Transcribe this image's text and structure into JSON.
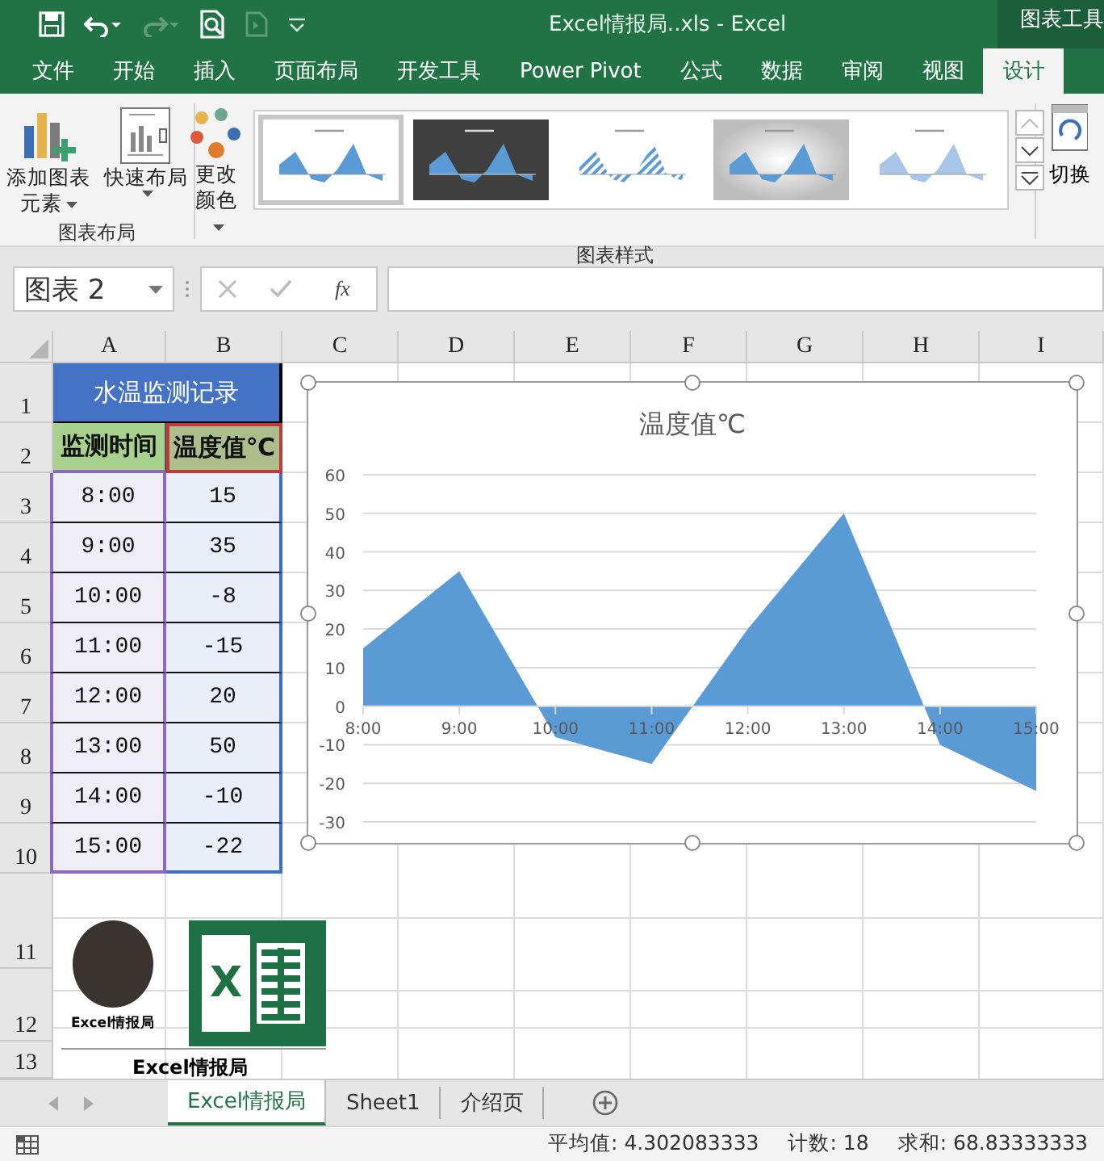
{
  "title_bar": {
    "title": "Excel情报局..xls - Excel",
    "context_tab": "图表工具"
  },
  "ribbon_tabs": [
    {
      "label": "文件",
      "selected": false
    },
    {
      "label": "开始",
      "selected": false
    },
    {
      "label": "插入",
      "selected": false
    },
    {
      "label": "页面布局",
      "selected": false
    },
    {
      "label": "开发工具",
      "selected": false
    },
    {
      "label": "Power Pivot",
      "selected": false
    },
    {
      "label": "公式",
      "selected": false
    },
    {
      "label": "数据",
      "selected": false
    },
    {
      "label": "审阅",
      "selected": false
    },
    {
      "label": "视图",
      "selected": false
    },
    {
      "label": "设计",
      "selected": true
    }
  ],
  "ribbon": {
    "layout_group": {
      "label": "图表布局",
      "buttons": [
        {
          "kind": "add",
          "label": "添加图表元素"
        },
        {
          "kind": "layout",
          "label": "快速布局"
        }
      ]
    },
    "styles_group": {
      "label": "图表样式",
      "color_button": "更改颜色",
      "styles": [
        {
          "kind": "light",
          "selected": true
        },
        {
          "kind": "dark",
          "selected": false
        },
        {
          "kind": "hatched",
          "selected": false
        },
        {
          "kind": "gradient",
          "selected": false
        },
        {
          "kind": "pale",
          "selected": false
        }
      ]
    },
    "switch_button": "切换"
  },
  "formula_bar": {
    "name_box": "图表 2",
    "function_label": "fx"
  },
  "columns": [
    "A",
    "B",
    "C",
    "D",
    "E",
    "F",
    "G",
    "H",
    "I"
  ],
  "rows": [
    "1",
    "2",
    "3",
    "4",
    "5",
    "6",
    "7",
    "8",
    "9",
    "10",
    "11",
    "12",
    "13"
  ],
  "table": {
    "title": "水温监测记录",
    "headers": [
      "监测时间",
      "温度值℃"
    ],
    "rows": [
      [
        "8:00",
        "15"
      ],
      [
        "9:00",
        "35"
      ],
      [
        "10:00",
        "-8"
      ],
      [
        "11:00",
        "-15"
      ],
      [
        "12:00",
        "20"
      ],
      [
        "13:00",
        "50"
      ],
      [
        "14:00",
        "-10"
      ],
      [
        "15:00",
        "-22"
      ]
    ]
  },
  "chart": {
    "chart_data": {
      "type": "area",
      "grid": true,
      "categories": [
        "8:00",
        "9:00",
        "10:00",
        "11:00",
        "12:00",
        "13:00",
        "14:00",
        "15:00"
      ],
      "series": [
        {
          "name": "温度值℃",
          "color": "#5b9bd5",
          "values": [
            15,
            35,
            -8,
            -15,
            20,
            50,
            -10,
            -22
          ]
        }
      ],
      "ylim": [
        -30,
        60
      ],
      "yticks": [
        -30,
        -20,
        -10,
        0,
        10,
        20,
        30,
        40,
        50,
        60
      ]
    }
  },
  "logo": {
    "avatar_caption": "Excel情报局",
    "letter": "X",
    "caption": "Excel情报局"
  },
  "sheet_tabs": [
    {
      "label": "Excel情报局",
      "selected": true
    },
    {
      "label": "Sheet1",
      "selected": false
    },
    {
      "label": "介绍页",
      "selected": false
    }
  ],
  "status_bar": [
    "平均值: 4.302083333",
    "计数: 18",
    "求和: 68.83333333"
  ]
}
